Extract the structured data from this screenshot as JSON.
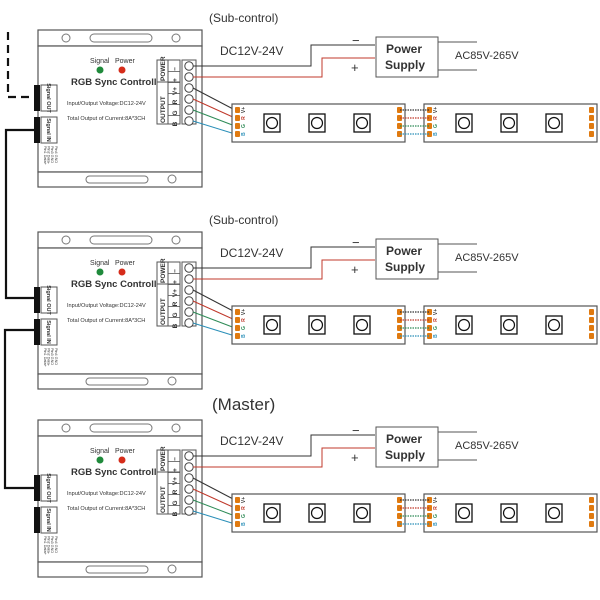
{
  "colors": {
    "wire_black": "#333333",
    "wire_red": "#c0392b",
    "wire_green": "#2e8b57",
    "wire_blue": "#2a8fb8",
    "led_signal": "#1f8a3b",
    "led_power": "#d62c1a",
    "pad": "#e07a10",
    "line": "#666666"
  },
  "controller": {
    "led_signal_label": "Signal",
    "led_power_label": "Power",
    "title": "RGB Sync Controller",
    "voltage": "Input/Output Voltage:DC12-24V",
    "current": "Total Output of Current:8A*3CH",
    "power_group": "POWER",
    "output_group": "OUTPUT",
    "power_terminals": [
      "−",
      "+"
    ],
    "output_terminals": [
      "V+",
      "R",
      "G",
      "B"
    ],
    "signal_out": "Signal OUT",
    "signal_in": "Signal IN",
    "pins": [
      "Pin1 Data+",
      "Pin2 Data-",
      "Pin3 GND",
      "Pin4 GND"
    ]
  },
  "stages": [
    {
      "role": "(Sub-control)",
      "dc": "DC12V-24V",
      "ac": "AC85V-265V",
      "psu_line1": "Power",
      "psu_line2": "Supply",
      "minus": "−",
      "plus": "+"
    },
    {
      "role": "(Sub-control)",
      "dc": "DC12V-24V",
      "ac": "AC85V-265V",
      "psu_line1": "Power",
      "psu_line2": "Supply",
      "minus": "−",
      "plus": "+"
    },
    {
      "role": "(Master)",
      "dc": "DC12V-24V",
      "ac": "AC85V-265V",
      "psu_line1": "Power",
      "psu_line2": "Supply",
      "minus": "−",
      "plus": "+"
    }
  ],
  "strip": {
    "pin_labels": [
      "V+",
      "R",
      "G",
      "B"
    ],
    "leds_per_segment": 3,
    "segments_per_stage": 2
  }
}
